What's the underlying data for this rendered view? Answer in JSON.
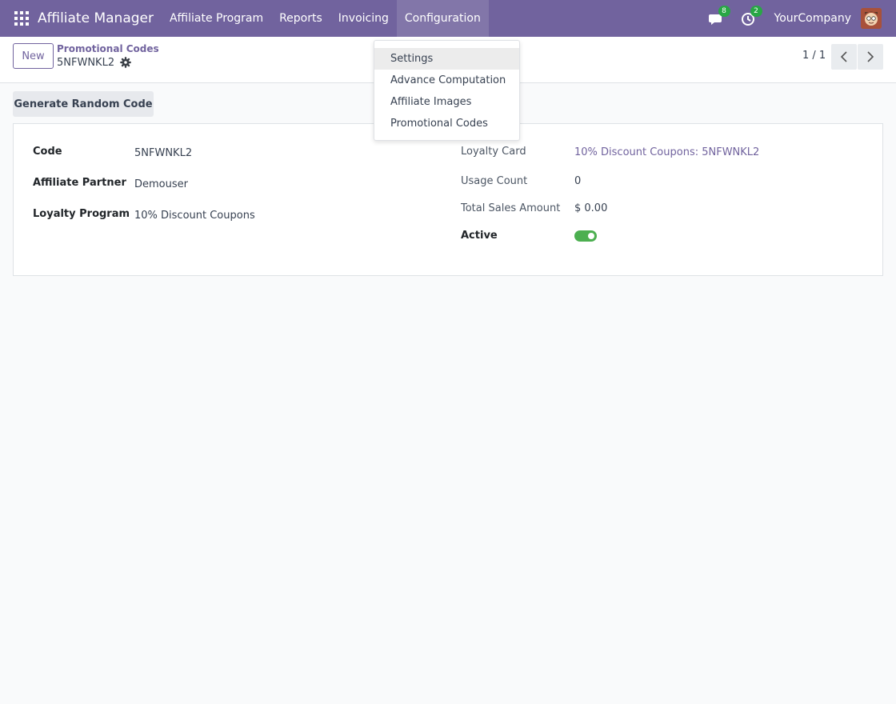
{
  "navbar": {
    "app_name": "Affiliate Manager",
    "menu": [
      "Affiliate Program",
      "Reports",
      "Invoicing",
      "Configuration"
    ],
    "messages_count": "8",
    "activities_count": "2",
    "company": "YourCompany",
    "color": "#71639e"
  },
  "config_menu": {
    "items": [
      "Settings",
      "Advance Computation",
      "Affiliate Images",
      "Promotional Codes"
    ]
  },
  "control_panel": {
    "new_label": "New",
    "breadcrumb_parent": "Promotional Codes",
    "breadcrumb_current": "5NFWNKL2",
    "pager": "1 / 1"
  },
  "form": {
    "generate_label": "Generate Random Code",
    "left": [
      {
        "label": "Code",
        "value": "5NFWNKL2"
      },
      {
        "label": "Affiliate Partner",
        "value": "Demouser"
      },
      {
        "label": "Loyalty Program",
        "value": "10% Discount Coupons"
      }
    ],
    "right": [
      {
        "label": "Loyalty Card",
        "value": "10% Discount Coupons: 5NFWNKL2"
      },
      {
        "label": "Usage Count",
        "value": "0"
      },
      {
        "label": "Total Sales Amount",
        "value": "$ 0.00"
      },
      {
        "label": "Active",
        "value": true
      }
    ],
    "toggle_color": "#4caf50"
  }
}
